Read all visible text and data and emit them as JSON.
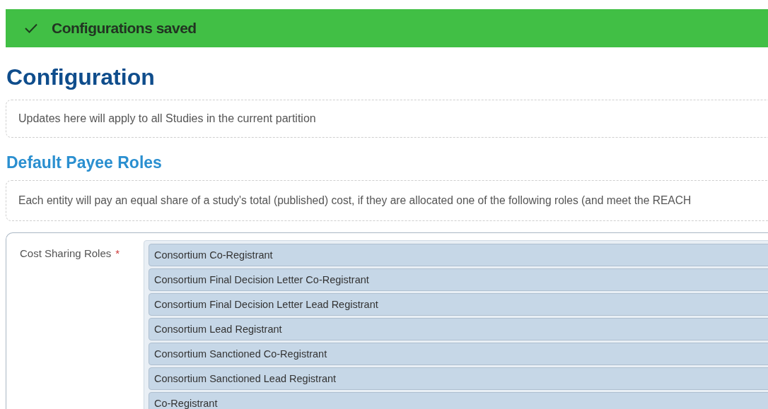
{
  "banner": {
    "kind": "success",
    "message": "Configurations saved"
  },
  "title": "Configuration",
  "notice": "Updates here will apply to all Studies in the current partition",
  "section": {
    "heading": "Default Payee Roles",
    "description": "Each entity will pay an equal share of a study's total (published) cost, if they are allocated one of the following roles (and meet the REACH"
  },
  "field": {
    "label": "Cost Sharing Roles",
    "required_mark": "*",
    "values": [
      "Consortium Co-Registrant",
      "Consortium Final Decision Letter Co-Registrant",
      "Consortium Final Decision Letter Lead Registrant",
      "Consortium Lead Registrant",
      "Consortium Sanctioned Co-Registrant",
      "Consortium Sanctioned Lead Registrant",
      "Co-Registrant"
    ]
  }
}
